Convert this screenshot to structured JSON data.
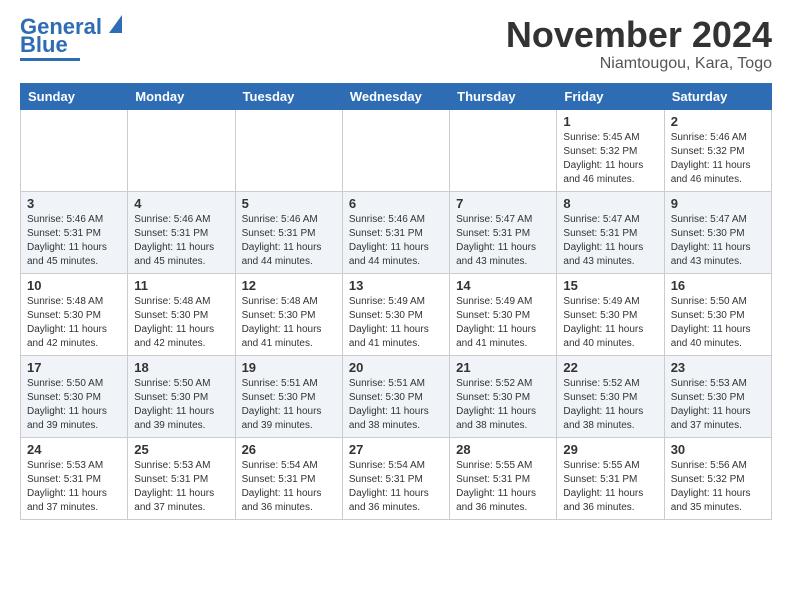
{
  "logo": {
    "text1": "General",
    "text2": "Blue"
  },
  "title": "November 2024",
  "location": "Niamtougou, Kara, Togo",
  "weekdays": [
    "Sunday",
    "Monday",
    "Tuesday",
    "Wednesday",
    "Thursday",
    "Friday",
    "Saturday"
  ],
  "weeks": [
    [
      {
        "day": "",
        "info": ""
      },
      {
        "day": "",
        "info": ""
      },
      {
        "day": "",
        "info": ""
      },
      {
        "day": "",
        "info": ""
      },
      {
        "day": "",
        "info": ""
      },
      {
        "day": "1",
        "info": "Sunrise: 5:45 AM\nSunset: 5:32 PM\nDaylight: 11 hours and 46 minutes."
      },
      {
        "day": "2",
        "info": "Sunrise: 5:46 AM\nSunset: 5:32 PM\nDaylight: 11 hours and 46 minutes."
      }
    ],
    [
      {
        "day": "3",
        "info": "Sunrise: 5:46 AM\nSunset: 5:31 PM\nDaylight: 11 hours and 45 minutes."
      },
      {
        "day": "4",
        "info": "Sunrise: 5:46 AM\nSunset: 5:31 PM\nDaylight: 11 hours and 45 minutes."
      },
      {
        "day": "5",
        "info": "Sunrise: 5:46 AM\nSunset: 5:31 PM\nDaylight: 11 hours and 44 minutes."
      },
      {
        "day": "6",
        "info": "Sunrise: 5:46 AM\nSunset: 5:31 PM\nDaylight: 11 hours and 44 minutes."
      },
      {
        "day": "7",
        "info": "Sunrise: 5:47 AM\nSunset: 5:31 PM\nDaylight: 11 hours and 43 minutes."
      },
      {
        "day": "8",
        "info": "Sunrise: 5:47 AM\nSunset: 5:31 PM\nDaylight: 11 hours and 43 minutes."
      },
      {
        "day": "9",
        "info": "Sunrise: 5:47 AM\nSunset: 5:30 PM\nDaylight: 11 hours and 43 minutes."
      }
    ],
    [
      {
        "day": "10",
        "info": "Sunrise: 5:48 AM\nSunset: 5:30 PM\nDaylight: 11 hours and 42 minutes."
      },
      {
        "day": "11",
        "info": "Sunrise: 5:48 AM\nSunset: 5:30 PM\nDaylight: 11 hours and 42 minutes."
      },
      {
        "day": "12",
        "info": "Sunrise: 5:48 AM\nSunset: 5:30 PM\nDaylight: 11 hours and 41 minutes."
      },
      {
        "day": "13",
        "info": "Sunrise: 5:49 AM\nSunset: 5:30 PM\nDaylight: 11 hours and 41 minutes."
      },
      {
        "day": "14",
        "info": "Sunrise: 5:49 AM\nSunset: 5:30 PM\nDaylight: 11 hours and 41 minutes."
      },
      {
        "day": "15",
        "info": "Sunrise: 5:49 AM\nSunset: 5:30 PM\nDaylight: 11 hours and 40 minutes."
      },
      {
        "day": "16",
        "info": "Sunrise: 5:50 AM\nSunset: 5:30 PM\nDaylight: 11 hours and 40 minutes."
      }
    ],
    [
      {
        "day": "17",
        "info": "Sunrise: 5:50 AM\nSunset: 5:30 PM\nDaylight: 11 hours and 39 minutes."
      },
      {
        "day": "18",
        "info": "Sunrise: 5:50 AM\nSunset: 5:30 PM\nDaylight: 11 hours and 39 minutes."
      },
      {
        "day": "19",
        "info": "Sunrise: 5:51 AM\nSunset: 5:30 PM\nDaylight: 11 hours and 39 minutes."
      },
      {
        "day": "20",
        "info": "Sunrise: 5:51 AM\nSunset: 5:30 PM\nDaylight: 11 hours and 38 minutes."
      },
      {
        "day": "21",
        "info": "Sunrise: 5:52 AM\nSunset: 5:30 PM\nDaylight: 11 hours and 38 minutes."
      },
      {
        "day": "22",
        "info": "Sunrise: 5:52 AM\nSunset: 5:30 PM\nDaylight: 11 hours and 38 minutes."
      },
      {
        "day": "23",
        "info": "Sunrise: 5:53 AM\nSunset: 5:30 PM\nDaylight: 11 hours and 37 minutes."
      }
    ],
    [
      {
        "day": "24",
        "info": "Sunrise: 5:53 AM\nSunset: 5:31 PM\nDaylight: 11 hours and 37 minutes."
      },
      {
        "day": "25",
        "info": "Sunrise: 5:53 AM\nSunset: 5:31 PM\nDaylight: 11 hours and 37 minutes."
      },
      {
        "day": "26",
        "info": "Sunrise: 5:54 AM\nSunset: 5:31 PM\nDaylight: 11 hours and 36 minutes."
      },
      {
        "day": "27",
        "info": "Sunrise: 5:54 AM\nSunset: 5:31 PM\nDaylight: 11 hours and 36 minutes."
      },
      {
        "day": "28",
        "info": "Sunrise: 5:55 AM\nSunset: 5:31 PM\nDaylight: 11 hours and 36 minutes."
      },
      {
        "day": "29",
        "info": "Sunrise: 5:55 AM\nSunset: 5:31 PM\nDaylight: 11 hours and 36 minutes."
      },
      {
        "day": "30",
        "info": "Sunrise: 5:56 AM\nSunset: 5:32 PM\nDaylight: 11 hours and 35 minutes."
      }
    ]
  ]
}
